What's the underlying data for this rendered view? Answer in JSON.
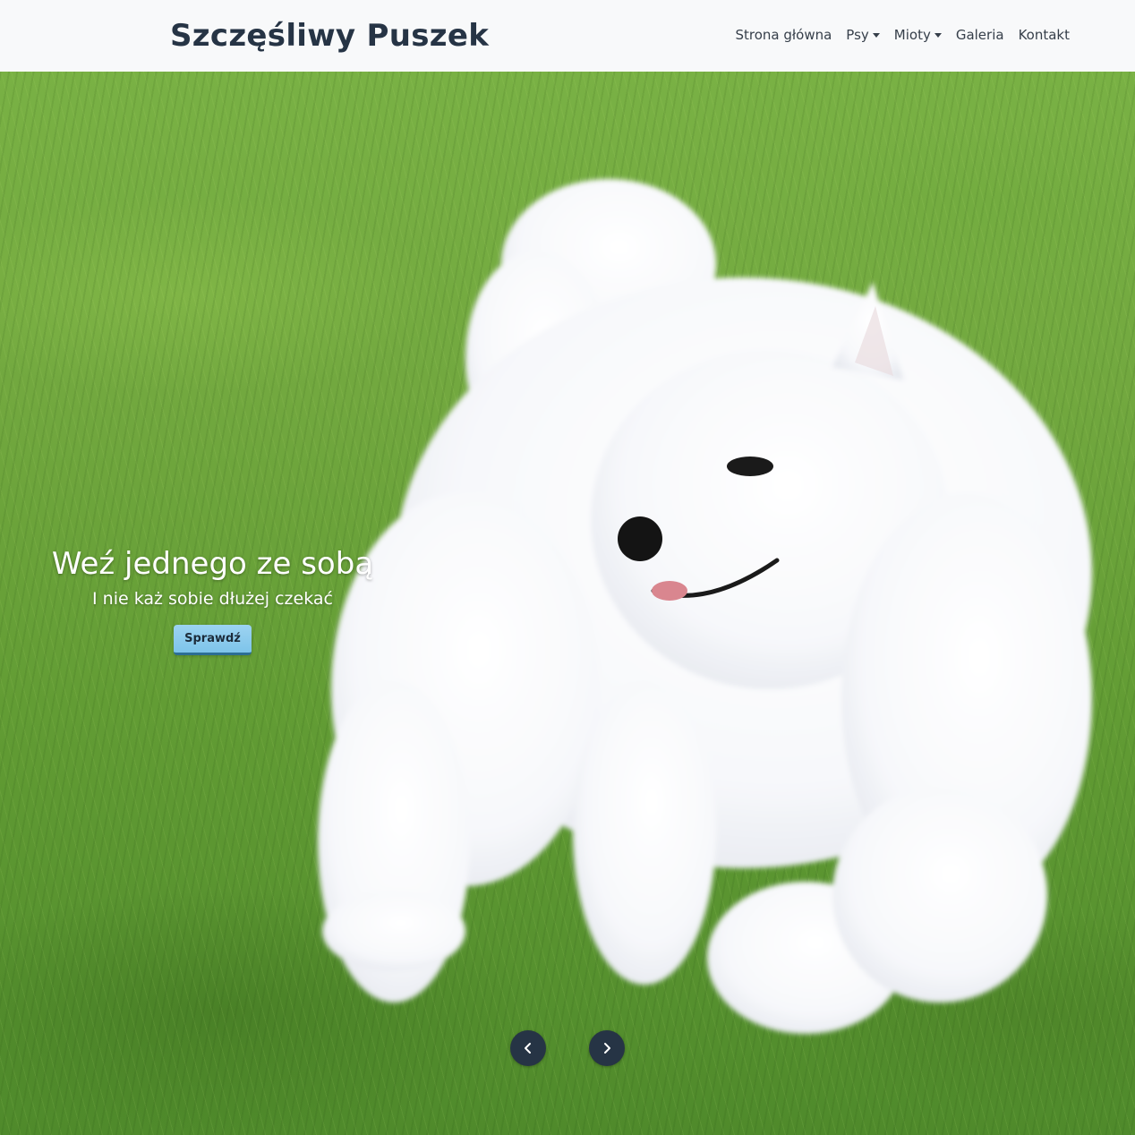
{
  "navbar": {
    "brand": "Szczęśliwy Puszek",
    "items": [
      {
        "label": "Strona główna",
        "dropdown": false
      },
      {
        "label": "Psy",
        "dropdown": true
      },
      {
        "label": "Mioty",
        "dropdown": true
      },
      {
        "label": "Galeria",
        "dropdown": false
      },
      {
        "label": "Kontakt",
        "dropdown": false
      }
    ]
  },
  "hero": {
    "image": "white-samoyed-puppy-on-grass",
    "caption_title": "Weź jednego ze sobą",
    "caption_subtitle": "I nie każ sobie dłużej czekać",
    "cta_label": "Sprawdź",
    "controls": {
      "prev_icon": "chevron-left-icon",
      "next_icon": "chevron-right-icon"
    }
  },
  "colors": {
    "navbar_bg": "#f8f9fa",
    "brand": "#263445",
    "nav_link": "#363f4a",
    "cta_bg": "#8ecbef",
    "control_bg": "#263445"
  }
}
